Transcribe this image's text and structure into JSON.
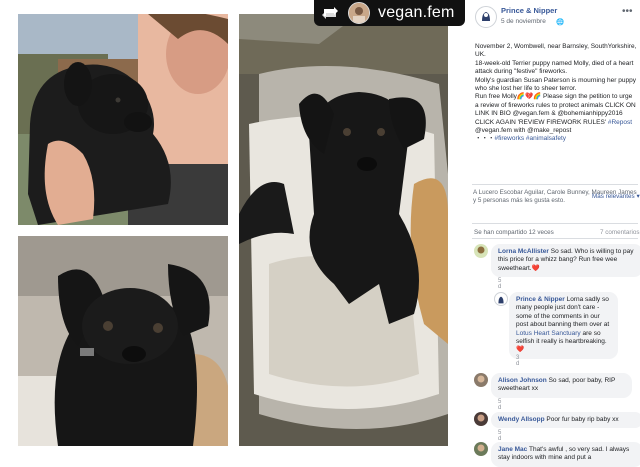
{
  "repost_badge": {
    "account": "vegan.fem",
    "icon": "repost-icon"
  },
  "post": {
    "page_name": "Prince & Nipper",
    "date": "5 de noviembre",
    "more": "•••",
    "globe": "🌐",
    "paragraphs": [
      "November 2, Wombwell, near Barnsley, SouthYorkshire, UK.",
      "18-week-old Terrier puppy named Molly, died of a heart attack during \"festive\" fireworks.",
      "Molly's guardian Susan Paterson is mourning her puppy who she lost her life to sheer terror."
    ],
    "run_free": "Run free Molly🌈💔🌈 Please sign the petition to urge a review of fireworks rules to protect animals CLICK ON LINK IN BIO @vegan.fem & @bohemianhippy2016 CLICK AGAIN 'REVIEW FIREWORK RULES'",
    "repost_tag": "#Repost",
    "repost_rest": " @vegan.fem with @make_repost",
    "dots": "・・・",
    "hashtags": "#fireworks #animalsafety"
  },
  "reactions": {
    "text": "A Lucero Escobar Aguilar, Carole Bunney, Maureen James y 5 personas más les gusta esto.",
    "more_relevant": "Más relevantes ▾",
    "shares": "Se han compartido 12 veces",
    "comments_count": "7 comentarios"
  },
  "comments": [
    {
      "author": "Lorna McAllister",
      "text": "So sad. Who is willing to pay this price for a whizz bang? Run free wee sweetheart.❤️",
      "time": "5 d"
    },
    {
      "author": "Prince & Nipper",
      "text": "Lorna sadly so many people just don't care - some of the comments in our post about banning them over at",
      "link": "Lotus Heart Sanctuary",
      "text2": " are so selfish it really is heartbreaking.❤️",
      "time": "3 d"
    },
    {
      "author": "Alison Johnson",
      "text": "So sad, poor baby, RIP sweetheart xx",
      "time": "5 d"
    },
    {
      "author": "Wendy Allsopp",
      "text": "Poor fur baby rip baby xx",
      "time": "5 d"
    },
    {
      "author": "Jane Mac",
      "text": "That's awful , so very sad. I always stay indoors with mine and put a"
    }
  ]
}
